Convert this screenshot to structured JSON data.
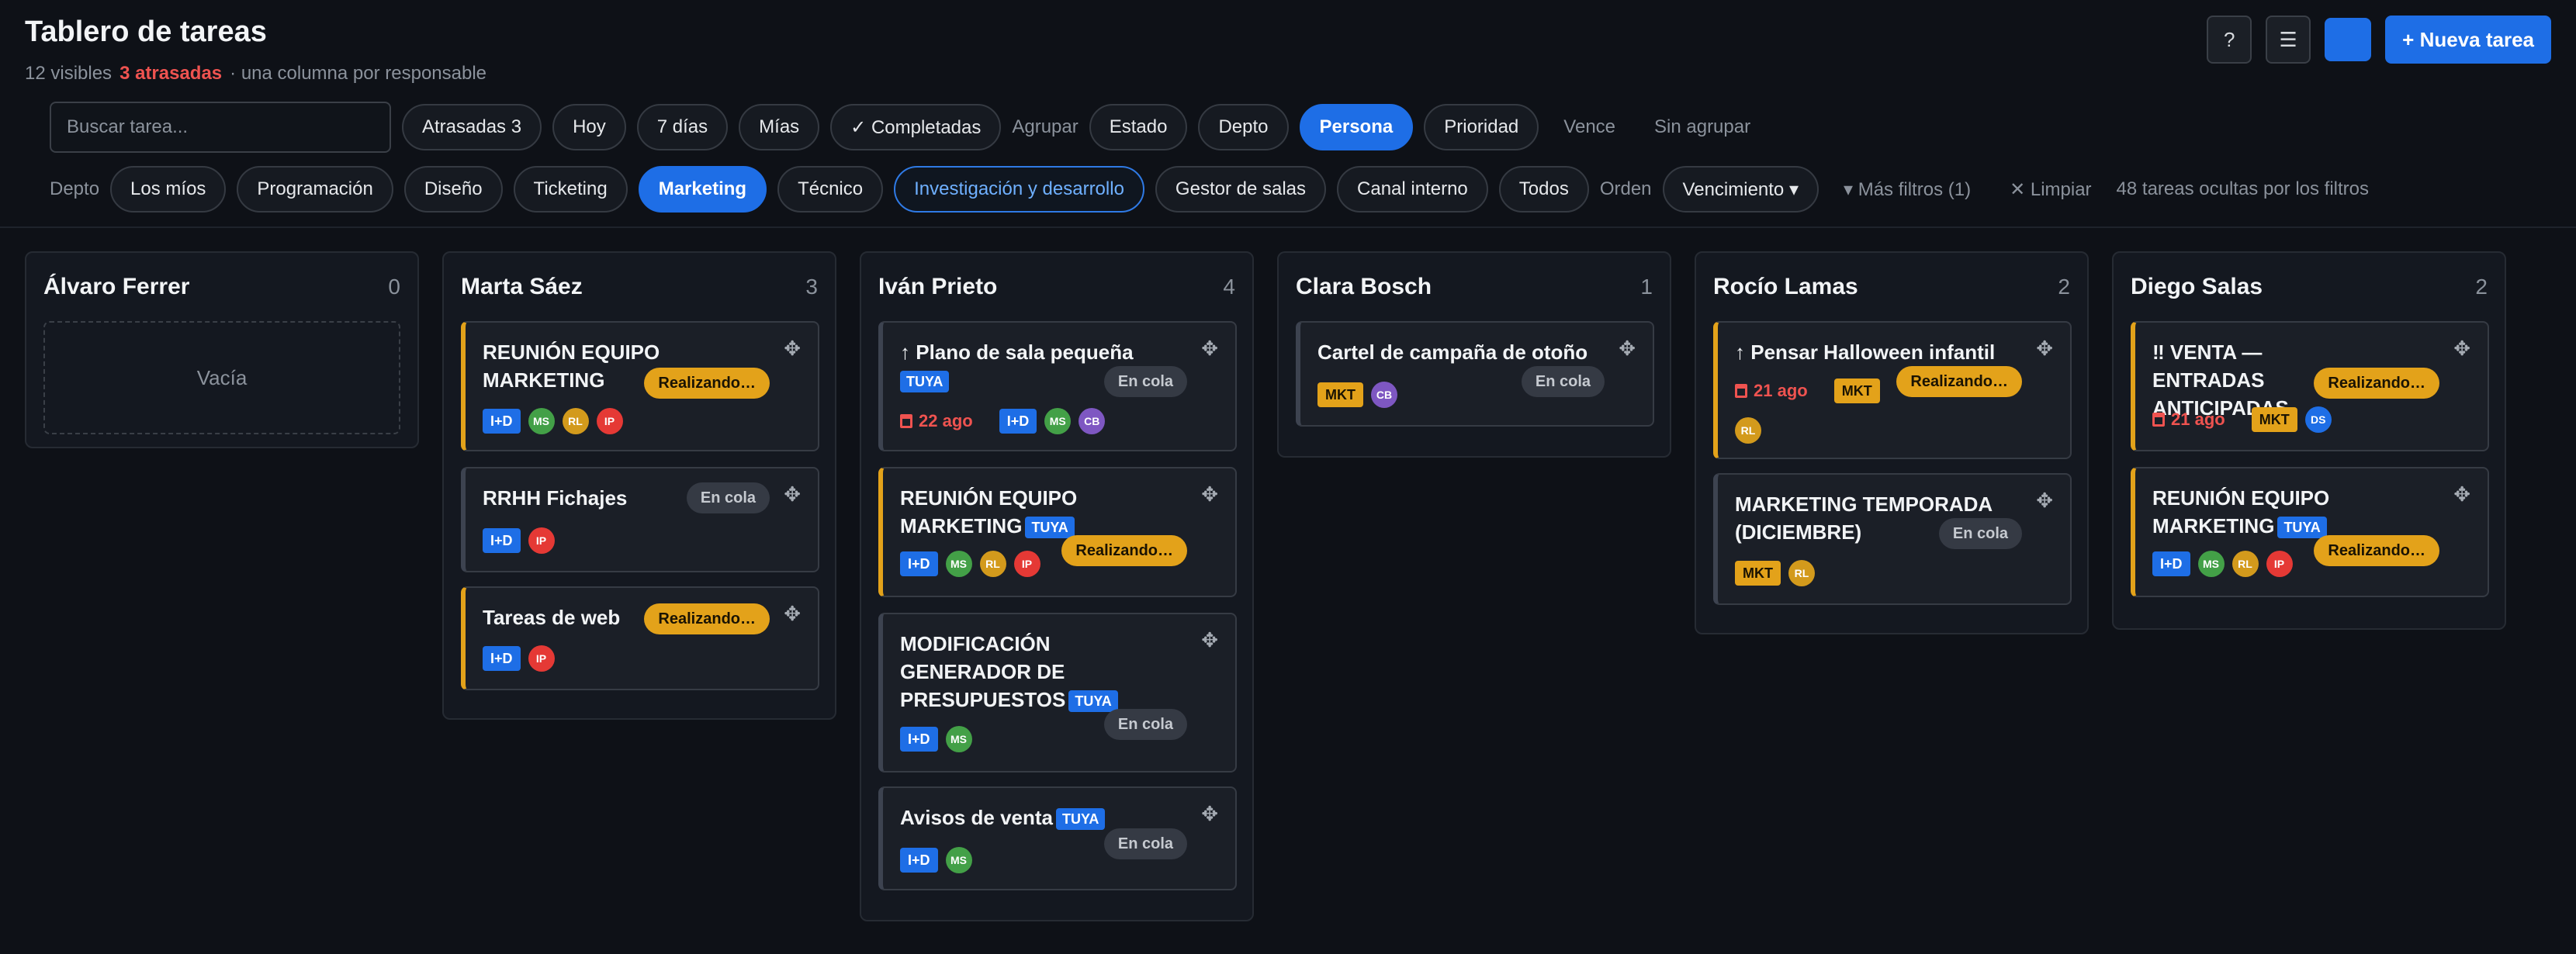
{
  "header": {
    "title": "Tablero de tareas",
    "visible": "12 visibles",
    "late": "3 atrasadas",
    "note": "· una columna por responsable",
    "help_label": "?",
    "menu_label": "☰",
    "new_task_label": "+ Nueva tarea"
  },
  "filters": {
    "search_placeholder": "Buscar tarea...",
    "quick": [
      "Atrasadas 3",
      "Hoy",
      "7 días",
      "Mías",
      "✓ Completadas"
    ],
    "group_label": "Agrupar",
    "group_options": [
      "Estado",
      "Depto",
      "Persona",
      "Prioridad",
      "Vence",
      "Sin agrupar"
    ],
    "group_selected": "Persona",
    "depto_label": "Depto",
    "depto_options": [
      "Los míos",
      "Programación",
      "Diseño",
      "Ticketing",
      "Marketing",
      "Técnico",
      "Investigación y desarrollo",
      "Gestor de salas",
      "Canal interno",
      "Todos"
    ],
    "depto_selected": "Marketing",
    "order_label": "Orden",
    "order_value": "Vencimiento ▾",
    "more_filters": "▾ Más filtros (1)",
    "clear": "✕ Limpiar",
    "hidden_note": "48 tareas ocultas por los filtros"
  },
  "columns": [
    {
      "name": "Álvaro Ferrer",
      "count": "0",
      "empty_label": "Vacía",
      "cards": []
    },
    {
      "name": "Marta Sáez",
      "count": "3",
      "cards": [
        {
          "title": "REUNIÓN EQUIPO MARKETING",
          "status": "Realizando…",
          "tag": "I+D",
          "avatars": [
            "MS",
            "RL",
            "IP"
          ]
        },
        {
          "title": "RRHH Fichajes",
          "status": "En cola",
          "tag": "I+D",
          "avatars": [
            "IP"
          ]
        },
        {
          "title": "Tareas de web",
          "status": "Realizando…",
          "tag": "I+D",
          "avatars": [
            "IP"
          ]
        }
      ]
    },
    {
      "name": "Iván Prieto",
      "count": "4",
      "cards": [
        {
          "title": "↑ Plano de sala pequeña",
          "tuya": "TUYA",
          "status": "En cola",
          "due": "22 ago",
          "tag": "I+D",
          "avatars": [
            "MS",
            "CB"
          ]
        },
        {
          "title": "REUNIÓN EQUIPO MARKETING",
          "tuya": "TUYA",
          "status": "Realizando…",
          "tag": "I+D",
          "avatars": [
            "MS",
            "RL",
            "IP"
          ]
        },
        {
          "title": "MODIFICACIÓN GENERADOR DE PRESUPUESTOS",
          "tuya": "TUYA",
          "status": "En cola",
          "tag": "I+D",
          "avatars": [
            "MS"
          ]
        },
        {
          "title": "Avisos de venta",
          "tuya": "TUYA",
          "status": "En cola",
          "tag": "I+D",
          "avatars": [
            "MS"
          ]
        }
      ]
    },
    {
      "name": "Clara Bosch",
      "count": "1",
      "cards": [
        {
          "title": "Cartel de campaña de otoño",
          "status": "En cola",
          "tag": "MKT",
          "avatars": [
            "CB"
          ]
        }
      ]
    },
    {
      "name": "Rocío Lamas",
      "count": "2",
      "cards": [
        {
          "title": "↑ Pensar Halloween infantil",
          "status": "Realizando…",
          "due": "21 ago",
          "tag": "MKT",
          "avatars": [
            "RL"
          ]
        },
        {
          "title": "MARKETING TEMPORADA (DICIEMBRE)",
          "status": "En cola",
          "tag": "MKT",
          "avatars": [
            "RL"
          ]
        }
      ]
    },
    {
      "name": "Diego Salas",
      "count": "2",
      "cards": [
        {
          "title": "‼ VENTA — ENTRADAS ANTICIPADAS",
          "status": "Realizando…",
          "due": "21 ago",
          "tag": "MKT",
          "avatars": [
            "DS"
          ]
        },
        {
          "title": "REUNIÓN EQUIPO MARKETING",
          "tuya": "TUYA",
          "status": "Realizando…",
          "tag": "I+D",
          "avatars": [
            "MS",
            "RL",
            "IP"
          ]
        }
      ]
    }
  ],
  "colors": {
    "accent": "#1e6ee6",
    "in_progress": "#e3a21a",
    "overdue": "#ef5350",
    "background": "#0e1117"
  }
}
